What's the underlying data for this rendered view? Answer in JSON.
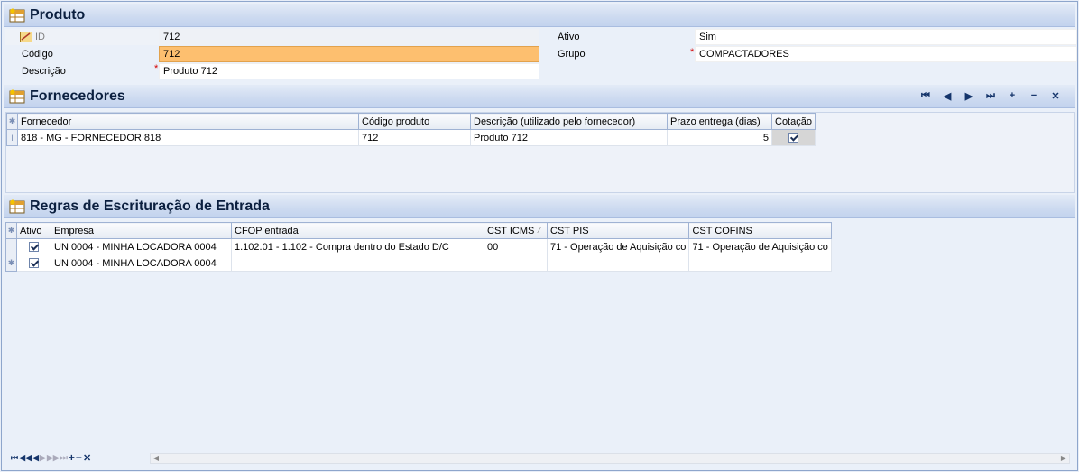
{
  "produto": {
    "title": "Produto",
    "fields": {
      "id_label": "ID",
      "id_value": "712",
      "codigo_label": "Código",
      "codigo_value": "712",
      "descricao_label": "Descrição",
      "descricao_value": "Produto 712",
      "ativo_label": "Ativo",
      "ativo_value": "Sim",
      "grupo_label": "Grupo",
      "grupo_value": "COMPACTADORES"
    },
    "required_mark": "*"
  },
  "fornecedores": {
    "title": "Fornecedores",
    "nav": [
      "first-icon",
      "prev-icon",
      "next-icon",
      "last-icon",
      "add-icon",
      "remove-icon",
      "cancel-icon"
    ],
    "columns": [
      "Fornecedor",
      "Código produto",
      "Descrição (utilizado pelo fornecedor)",
      "Prazo entrega (dias)",
      "Cotação"
    ],
    "rows": [
      {
        "fornecedor": "818 - MG - FORNECEDOR  818",
        "codigo": "712",
        "descricao": "Produto 712",
        "prazo": "5",
        "cotacao": true
      }
    ]
  },
  "regras": {
    "title": "Regras de Escrituração de Entrada",
    "columns": [
      "Ativo",
      "Empresa",
      "CFOP entrada",
      "CST ICMS",
      "CST PIS",
      "CST COFINS"
    ],
    "rows": [
      {
        "ativo": true,
        "empresa": "UN 0004 - MINHA LOCADORA 0004",
        "cfop": "1.102.01 - 1.102 - Compra dentro do Estado D/C",
        "icms": "00",
        "pis": "71 - Operação de Aquisição co",
        "cofins": "71 - Operação de Aquisição co"
      },
      {
        "ativo": true,
        "empresa": "UN 0004 - MINHA LOCADORA 0004",
        "cfop": "",
        "icms": "",
        "pis": "",
        "cofins": ""
      }
    ]
  },
  "colors": {
    "accent_focus": "#fdbf6f",
    "required": "#d40000",
    "header_text": "#0b1f3f"
  }
}
